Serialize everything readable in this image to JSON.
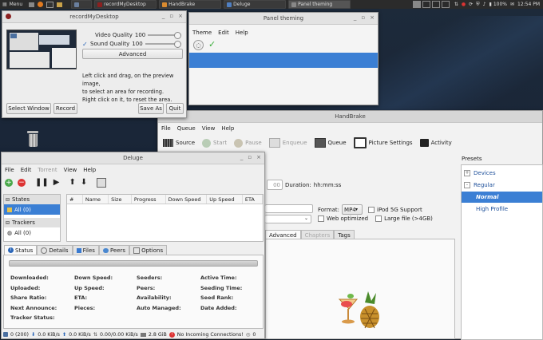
{
  "panel": {
    "menu_label": "Menu",
    "tasks": [
      {
        "label": "",
        "color": "#6a7f9e"
      },
      {
        "label": "recordMyDesktop",
        "color": "#8b2020"
      },
      {
        "label": "HandBrake",
        "color": "#d88a30"
      },
      {
        "label": "Deluge",
        "color": "#4f7fc2"
      },
      {
        "label": "Panel theming",
        "color": "#888888"
      }
    ],
    "battery": "100%",
    "clock": "12:54 PM"
  },
  "desktop": {
    "trash_icon": "trash-icon"
  },
  "recordmydesktop": {
    "title": "recordMyDesktop",
    "video_quality_label": "Video Quality",
    "video_quality_value": "100",
    "sound_quality_label": "Sound Quality",
    "sound_quality_value": "100",
    "sound_checked": true,
    "advanced_label": "Advanced",
    "help_text_1": "Left click and drag, on the preview image,",
    "help_text_2": "to select an area for recording.",
    "help_text_3": "Right click on it, to reset the area.",
    "select_window_label": "Select Window",
    "record_label": "Record",
    "save_as_label": "Save As",
    "quit_label": "Quit"
  },
  "panel_theming": {
    "title": "Panel theming",
    "menus": [
      "Theme",
      "Edit",
      "Help"
    ],
    "accent": "#3b7fd4"
  },
  "handbrake": {
    "title": "HandBrake",
    "menus": [
      "File",
      "Queue",
      "View",
      "Help"
    ],
    "toolbar": [
      "Source",
      "Start",
      "Pause",
      "Enqueue",
      "Queue",
      "Picture Settings",
      "Activity"
    ],
    "duration_label": "Duration:",
    "duration_value": "hh:mm:ss",
    "duration_num": "00",
    "format_label": "Format:",
    "format_value": "MP4",
    "ipod_label": "iPod 5G Support",
    "web_optimized_label": "Web optimized",
    "large_file_label": "Large file (>4GB)",
    "tabs": [
      "Advanced",
      "Chapters",
      "Tags"
    ],
    "presets_title": "Presets",
    "presets": [
      {
        "label": "Devices",
        "indent": 0,
        "expander": "+",
        "selected": false
      },
      {
        "label": "Regular",
        "indent": 0,
        "expander": "-",
        "selected": false
      },
      {
        "label": "Normal",
        "indent": 1,
        "expander": "",
        "selected": true
      },
      {
        "label": "High Profile",
        "indent": 1,
        "expander": "",
        "selected": false
      }
    ]
  },
  "deluge": {
    "title": "Deluge",
    "menus": [
      "File",
      "Edit",
      "Torrent",
      "View",
      "Help"
    ],
    "sidebar": {
      "states_header": "States",
      "states_all": "All (0)",
      "trackers_header": "Trackers",
      "trackers_all": "All (0)"
    },
    "columns": [
      "#",
      "Name",
      "Size",
      "Progress",
      "Down Speed",
      "Up Speed",
      "ETA"
    ],
    "tabs": [
      "Status",
      "Details",
      "Files",
      "Peers",
      "Options"
    ],
    "status_fields": [
      [
        "Downloaded:",
        "Down Speed:",
        "Seeders:",
        "Active Time:"
      ],
      [
        "Uploaded:",
        "Up Speed:",
        "Peers:",
        "Seeding Time:"
      ],
      [
        "Share Ratio:",
        "ETA:",
        "Availability:",
        "Seed Rank:"
      ],
      [
        "Next Announce:",
        "Pieces:",
        "Auto Managed:",
        "Date Added:"
      ],
      [
        "Tracker Status:",
        "",
        "",
        ""
      ]
    ],
    "statusbar": {
      "connections": "0 (200)",
      "down": "0.0 KiB/s",
      "up": "0.0 KiB/s",
      "proto": "0.00/0.00 KiB/s",
      "disk": "2.8 GiB",
      "incoming": "No Incoming Connections!",
      "dht": "0"
    }
  }
}
